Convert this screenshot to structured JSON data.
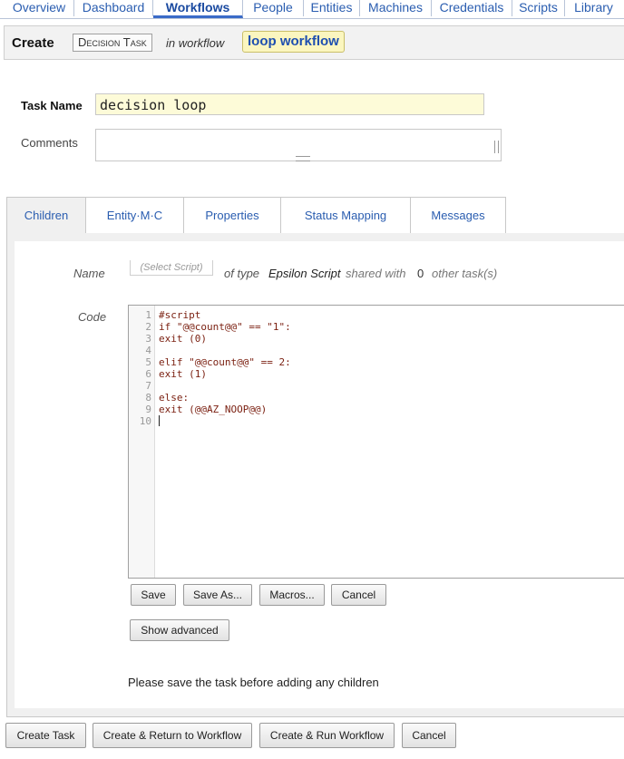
{
  "nav": {
    "tabs": [
      "Overview",
      "Dashboard",
      "Workflows",
      "People",
      "Entities",
      "Machines",
      "Credentials",
      "Scripts",
      "Library"
    ],
    "active": "Workflows"
  },
  "header": {
    "create": "Create",
    "task_type": "Decision Task",
    "in_workflow": "in workflow",
    "workflow_name": "loop workflow"
  },
  "form": {
    "task_name_label": "Task Name",
    "task_name_value": "decision loop",
    "comments_label": "Comments",
    "comments_value": ""
  },
  "tabs": [
    "Children",
    "Entity·M·C",
    "Properties",
    "Status Mapping",
    "Messages"
  ],
  "active_tab": "Children",
  "script": {
    "name_label": "Name",
    "select_placeholder": "(Select Script)",
    "of_type": "of type",
    "type_value": "Epsilon Script",
    "shared_with": "shared with",
    "shared_count": "0",
    "other_tasks": "other task(s)",
    "code_label": "Code"
  },
  "code_lines": [
    "#script",
    "if \"@@count@@\" == \"1\":",
    "exit (0)",
    "",
    "elif \"@@count@@\" == 2:",
    "exit (1)",
    "",
    "else:",
    "exit (@@AZ_NOOP@@)",
    ""
  ],
  "editor_buttons": [
    "Save",
    "Save As...",
    "Macros...",
    "Cancel"
  ],
  "show_advanced": "Show advanced",
  "children_msg": "Please save the task before adding any children",
  "bottom_buttons": [
    "Create Task",
    "Create & Return to Workflow",
    "Create & Run Workflow",
    "Cancel"
  ]
}
